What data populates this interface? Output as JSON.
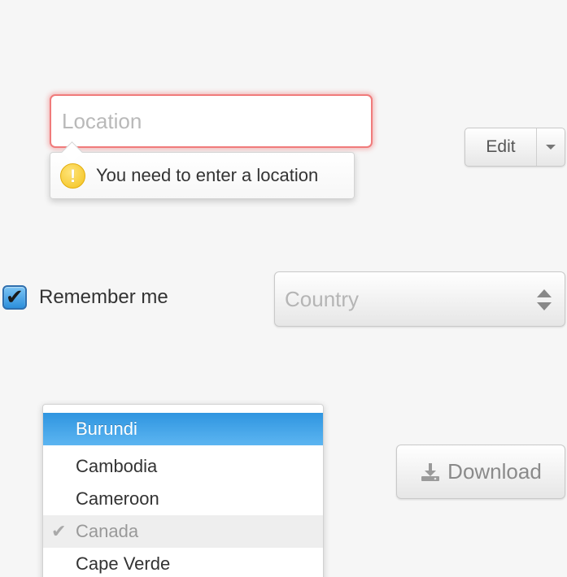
{
  "location_field": {
    "placeholder": "Location",
    "value": "",
    "error": {
      "message": "You need to enter a location",
      "icon": "warning-icon",
      "icon_glyph": "!",
      "color": "#f3c21d"
    },
    "glow_color": "#f07b7b"
  },
  "edit_split_button": {
    "label": "Edit",
    "toggle_icon": "caret-down-icon"
  },
  "remember_me": {
    "label": "Remember me",
    "checked": true,
    "check_glyph": "✔",
    "accent": "#2c8fdb"
  },
  "country_select": {
    "placeholder": "Country",
    "icon": "up-down-arrows-icon"
  },
  "country_dropdown": {
    "options": [
      {
        "label": "Burundi",
        "state": "highlighted"
      },
      {
        "label": "Cambodia",
        "state": "normal"
      },
      {
        "label": "Cameroon",
        "state": "normal"
      },
      {
        "label": "Canada",
        "state": "selected"
      },
      {
        "label": "Cape Verde",
        "state": "normal"
      }
    ],
    "highlight_color": "#2f95e0",
    "selected_glyph": "✔"
  },
  "download_button": {
    "label": "Download",
    "icon": "download-icon",
    "disabled": true
  }
}
